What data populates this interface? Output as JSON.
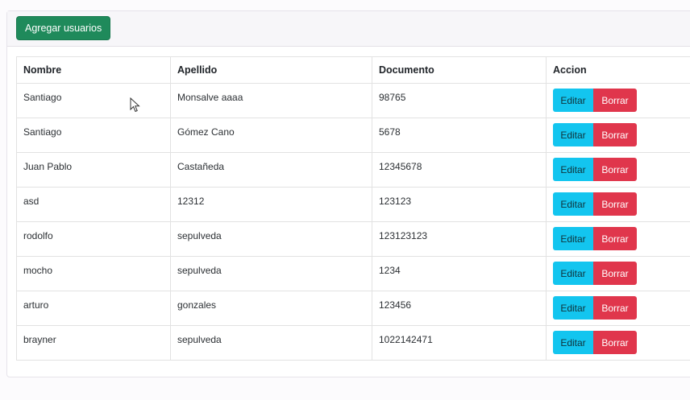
{
  "toolbar": {
    "add_label": "Agregar usuarios"
  },
  "table": {
    "headers": [
      "Nombre",
      "Apellido",
      "Documento",
      "Accion"
    ],
    "rows": [
      {
        "nombre": "Santiago",
        "apellido": "Monsalve aaaa",
        "documento": "98765"
      },
      {
        "nombre": "Santiago",
        "apellido": "Gómez Cano",
        "documento": "5678"
      },
      {
        "nombre": "Juan Pablo",
        "apellido": "Castañeda",
        "documento": "12345678"
      },
      {
        "nombre": "asd",
        "apellido": "12312",
        "documento": "123123"
      },
      {
        "nombre": "rodolfo",
        "apellido": "sepulveda",
        "documento": "123123123"
      },
      {
        "nombre": "mocho",
        "apellido": "sepulveda",
        "documento": "1234"
      },
      {
        "nombre": "arturo",
        "apellido": "gonzales",
        "documento": "123456"
      },
      {
        "nombre": "brayner",
        "apellido": "sepulveda",
        "documento": "1022142471"
      }
    ],
    "edit_label": "Editar",
    "delete_label": "Borrar"
  },
  "colors": {
    "add_button": "#1f8a5b",
    "edit_button": "#13c5ef",
    "delete_button": "#e0364c"
  },
  "icons": {
    "cursor": "mouse-pointer-icon"
  }
}
